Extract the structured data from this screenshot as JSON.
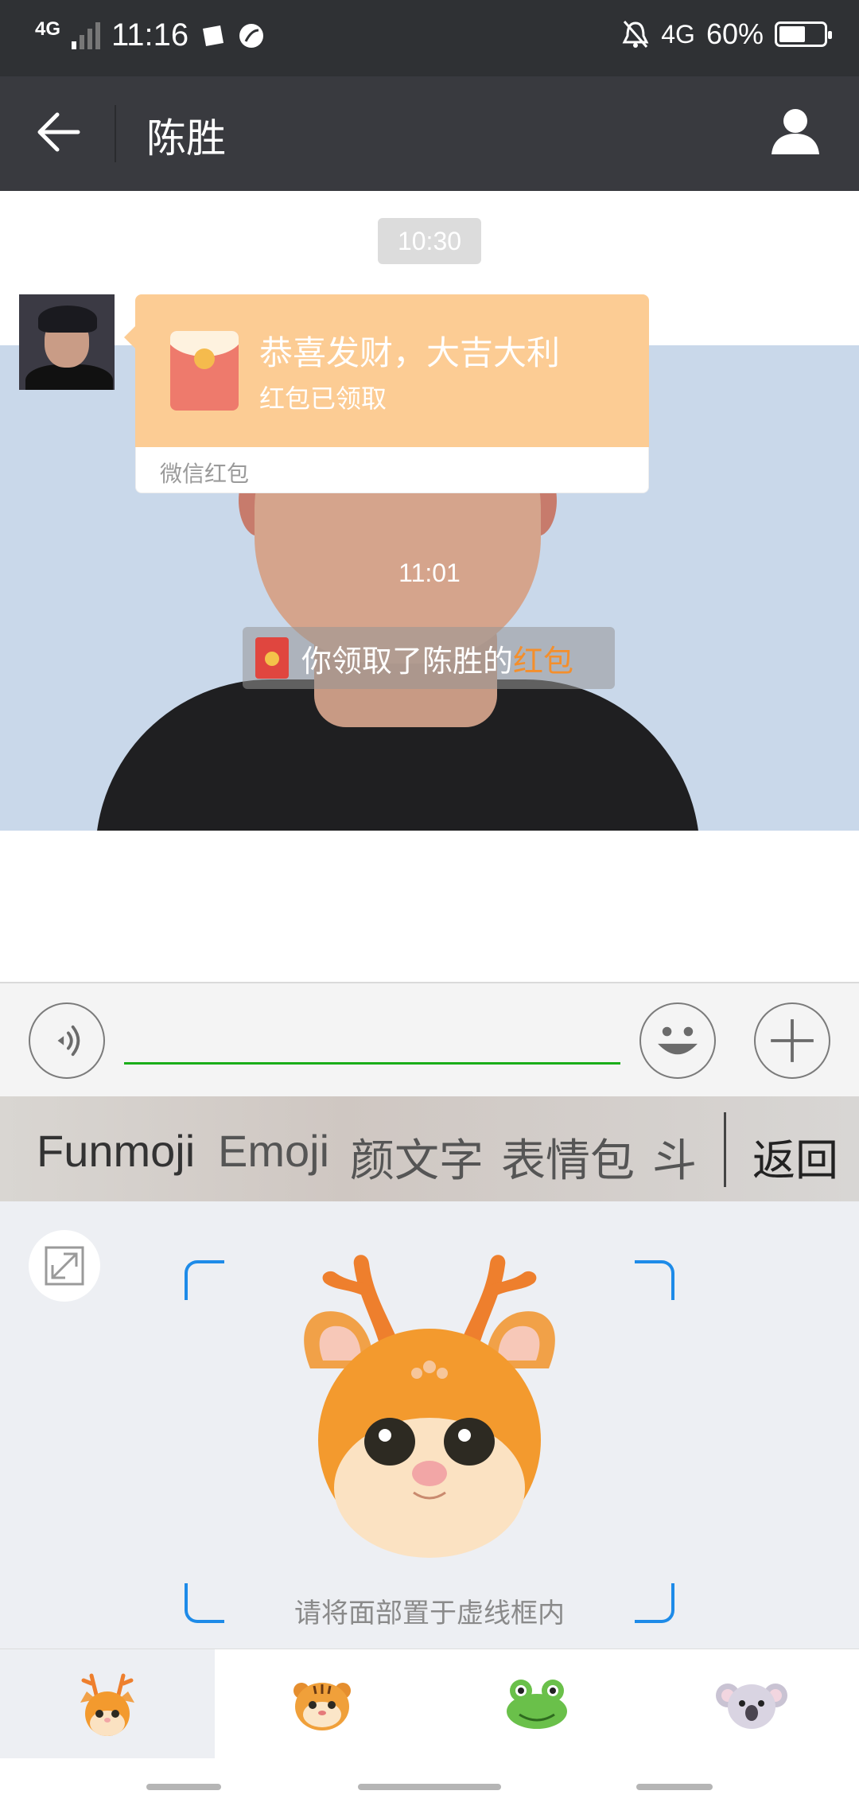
{
  "status_bar": {
    "network_left": "4G",
    "time": "11:16",
    "network_right": "4G",
    "battery_percent": "60%",
    "battery_level": 0.6
  },
  "header": {
    "title": "陈胜"
  },
  "chat": {
    "timestamp_1": "10:30",
    "red_packet": {
      "greeting": "恭喜发财，大吉大利",
      "status": "红包已领取",
      "footer": "微信红包"
    },
    "timestamp_2": "11:01",
    "system_message": {
      "text": "你领取了陈胜的",
      "link": "红包"
    }
  },
  "input_bar": {
    "value": ""
  },
  "emoji_tabs": {
    "items": [
      "Funmoji",
      "Emoji",
      "颜文字",
      "表情包",
      "斗"
    ],
    "back": "返回"
  },
  "funmoji": {
    "hint": "请将面部置于虚线框内",
    "characters": [
      "deer",
      "tiger",
      "frog",
      "koala"
    ],
    "selected": "deer"
  },
  "colors": {
    "header_bg": "#393a3f",
    "red_packet": "#fccc94",
    "link": "#f48f2c",
    "input_underline": "#1aad19",
    "frame_corner": "#1e8be8"
  }
}
